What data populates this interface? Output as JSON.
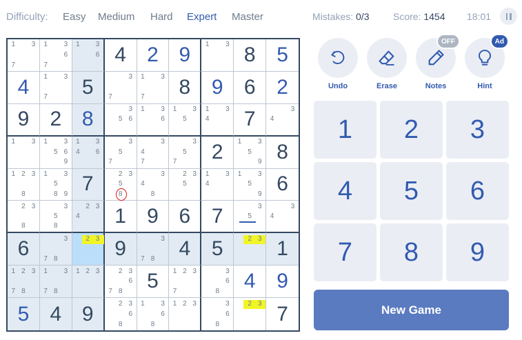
{
  "header": {
    "difficulty_label": "Difficulty:",
    "levels": [
      {
        "label": "Easy",
        "active": false
      },
      {
        "label": "Medium",
        "active": false
      },
      {
        "label": "Hard",
        "active": false
      },
      {
        "label": "Expert",
        "active": true
      },
      {
        "label": "Master",
        "active": false
      }
    ],
    "mistakes_label": "Mistakes:",
    "mistakes_value": "0/3",
    "score_label": "Score:",
    "score_value": "1454",
    "timer": "18:01"
  },
  "board": {
    "rows": [
      [
        {
          "n": [
            "1",
            "",
            "3",
            "",
            "",
            "",
            "7",
            "",
            ""
          ]
        },
        {
          "n": [
            "1",
            "",
            "3",
            "",
            "",
            "6",
            "7",
            "",
            ""
          ]
        },
        {
          "n": [
            "1",
            "",
            "3",
            "",
            "",
            "6",
            "",
            "",
            ""
          ]
        },
        {
          "v": "4"
        },
        {
          "v": "2",
          "u": true
        },
        {
          "v": "9",
          "u": true
        },
        {
          "n": [
            "1",
            "",
            "3",
            "",
            "",
            "",
            "",
            "",
            ""
          ]
        },
        {
          "v": "8"
        },
        {
          "v": "5",
          "u": true
        }
      ],
      [
        {
          "v": "4",
          "u": true
        },
        {
          "n": [
            "1",
            "",
            "3",
            "",
            "",
            "",
            "7",
            "",
            ""
          ]
        },
        {
          "v": "5"
        },
        {
          "n": [
            "",
            "",
            "3",
            "",
            "",
            "",
            "7",
            "",
            ""
          ]
        },
        {
          "n": [
            "1",
            "",
            "3",
            "",
            "",
            "",
            "7",
            "",
            ""
          ]
        },
        {
          "v": "8"
        },
        {
          "v": "9",
          "u": true
        },
        {
          "v": "6"
        },
        {
          "v": "2",
          "u": true
        }
      ],
      [
        {
          "v": "9"
        },
        {
          "v": "2"
        },
        {
          "v": "8",
          "u": true
        },
        {
          "n": [
            "",
            "",
            "3",
            "",
            "5",
            "6",
            "",
            "",
            ""
          ]
        },
        {
          "n": [
            "1",
            "",
            "3",
            "",
            "",
            "6",
            "",
            "",
            ""
          ]
        },
        {
          "n": [
            "1",
            "",
            "3",
            "",
            "5",
            "",
            "",
            "",
            ""
          ]
        },
        {
          "n": [
            "1",
            "",
            "3",
            "4",
            "",
            "",
            "",
            "",
            ""
          ]
        },
        {
          "v": "7"
        },
        {
          "n": [
            "",
            "",
            "3",
            "4",
            "",
            "",
            "",
            "",
            ""
          ]
        }
      ],
      [
        {
          "n": [
            "1",
            "",
            "3",
            "",
            "",
            "",
            "",
            "",
            ""
          ]
        },
        {
          "n": [
            "1",
            "",
            "3",
            "",
            "5",
            "6",
            "",
            "",
            "9"
          ]
        },
        {
          "n": [
            "1",
            "",
            "3",
            "4",
            "",
            "6",
            "",
            "",
            ""
          ]
        },
        {
          "n": [
            "",
            "",
            "3",
            "",
            "5",
            "",
            "7",
            "",
            ""
          ]
        },
        {
          "n": [
            "",
            "",
            "3",
            "4",
            "",
            "",
            "7",
            "",
            ""
          ]
        },
        {
          "n": [
            "",
            "",
            "3",
            "",
            "5",
            "",
            "7",
            "",
            ""
          ]
        },
        {
          "v": "2"
        },
        {
          "n": [
            "1",
            "",
            "3",
            "",
            "5",
            "",
            "",
            "",
            "9"
          ]
        },
        {
          "v": "8"
        }
      ],
      [
        {
          "n": [
            "1",
            "2",
            "3",
            "",
            "",
            "",
            "",
            "8",
            ""
          ]
        },
        {
          "n": [
            "1",
            "",
            "3",
            "",
            "5",
            "",
            "",
            "8",
            "9"
          ]
        },
        {
          "v": "7"
        },
        {
          "n": [
            "",
            "2",
            "3",
            "",
            "5",
            "",
            "",
            "8",
            ""
          ]
        },
        {
          "n": [
            "",
            "",
            "3",
            "4",
            "",
            "",
            "",
            "8",
            ""
          ]
        },
        {
          "n": [
            "",
            "2",
            "3",
            "",
            "5",
            "",
            "",
            "",
            ""
          ]
        },
        {
          "n": [
            "1",
            "",
            "3",
            "4",
            "",
            "",
            "",
            "",
            ""
          ]
        },
        {
          "n": [
            "1",
            "",
            "3",
            "",
            "5",
            "",
            "",
            "",
            "9"
          ]
        },
        {
          "v": "6"
        }
      ],
      [
        {
          "n": [
            "",
            "2",
            "3",
            "",
            "",
            "",
            "",
            "8",
            ""
          ]
        },
        {
          "n": [
            "",
            "",
            "3",
            "",
            "5",
            "",
            "",
            "8",
            ""
          ]
        },
        {
          "n": [
            "",
            "2",
            "3",
            "4",
            "",
            "",
            "",
            "",
            ""
          ]
        },
        {
          "v": "1"
        },
        {
          "v": "9"
        },
        {
          "v": "6"
        },
        {
          "v": "7"
        },
        {
          "n": [
            "",
            "",
            "3",
            "",
            "5",
            "",
            "",
            "",
            ""
          ]
        },
        {
          "n": [
            "",
            "",
            "3",
            "4",
            "",
            "",
            "",
            "",
            ""
          ]
        }
      ],
      [
        {
          "v": "6"
        },
        {
          "n": [
            "",
            "",
            "3",
            "",
            "",
            "",
            "7",
            "8",
            ""
          ]
        },
        {
          "n": [
            "",
            "2",
            "3",
            "",
            "",
            "",
            "",
            "",
            ""
          ]
        },
        {
          "v": "9"
        },
        {
          "n": [
            "",
            "",
            "3",
            "",
            "",
            "",
            "7",
            "8",
            ""
          ]
        },
        {
          "v": "4"
        },
        {
          "v": "5"
        },
        {
          "n": [
            "",
            "2",
            "3",
            "",
            "",
            "",
            "",
            "",
            ""
          ]
        },
        {
          "v": "1"
        }
      ],
      [
        {
          "n": [
            "1",
            "2",
            "3",
            "",
            "",
            "",
            "7",
            "8",
            ""
          ]
        },
        {
          "n": [
            "1",
            "",
            "3",
            "",
            "",
            "",
            "7",
            "8",
            ""
          ]
        },
        {
          "n": [
            "1",
            "2",
            "3",
            "",
            "",
            "",
            "",
            "",
            ""
          ]
        },
        {
          "n": [
            "",
            "2",
            "3",
            "",
            "",
            "6",
            "7",
            "8",
            ""
          ]
        },
        {
          "v": "5"
        },
        {
          "n": [
            "1",
            "2",
            "3",
            "",
            "",
            "",
            "7",
            "",
            ""
          ]
        },
        {
          "n": [
            "",
            "",
            "3",
            "",
            "",
            "6",
            "",
            "8",
            ""
          ]
        },
        {
          "v": "4",
          "u": true
        },
        {
          "v": "9",
          "u": true
        }
      ],
      [
        {
          "v": "5",
          "u": true
        },
        {
          "v": "4"
        },
        {
          "v": "9"
        },
        {
          "n": [
            "",
            "2",
            "3",
            "",
            "",
            "6",
            "",
            "8",
            ""
          ]
        },
        {
          "n": [
            "1",
            "",
            "3",
            "",
            "",
            "6",
            "",
            "8",
            ""
          ]
        },
        {
          "n": [
            "1",
            "2",
            "3",
            "",
            "",
            "",
            "",
            "",
            ""
          ]
        },
        {
          "n": [
            "",
            "",
            "3",
            "",
            "",
            "6",
            "",
            "8",
            ""
          ]
        },
        {
          "n": [
            "",
            "2",
            "3",
            "",
            "",
            "",
            "",
            "",
            ""
          ]
        },
        {
          "v": "7"
        }
      ]
    ]
  },
  "tools": [
    {
      "label": "Undo",
      "icon": "undo-icon",
      "badge": ""
    },
    {
      "label": "Erase",
      "icon": "eraser-icon",
      "badge": ""
    },
    {
      "label": "Notes",
      "icon": "pencil-icon",
      "badge": "OFF"
    },
    {
      "label": "Hint",
      "icon": "lightbulb-icon",
      "badge": "Ad"
    }
  ],
  "numpad": [
    "1",
    "2",
    "3",
    "4",
    "5",
    "6",
    "7",
    "8",
    "9"
  ],
  "new_game_label": "New Game",
  "annotations": {
    "red_circles": [
      [
        1,
        4,
        8
      ],
      [
        5,
        4,
        8
      ],
      [
        6,
        5,
        8
      ],
      [
        7,
        6,
        3
      ],
      [
        7,
        7,
        5
      ],
      [
        8,
        7,
        7
      ],
      [
        9,
        7,
        5
      ]
    ],
    "yellow_pairs": [
      [
        7,
        3
      ],
      [
        7,
        8
      ],
      [
        9,
        8
      ]
    ],
    "selected": [
      7,
      3
    ],
    "underline": [
      6,
      8
    ]
  },
  "colors": {
    "accent": "#325aaf",
    "given": "#344861",
    "highlight": "#e2ebf3",
    "selected": "#bbdefb",
    "marker_red": "#e01515",
    "marker_yellow": "#f1f526"
  }
}
